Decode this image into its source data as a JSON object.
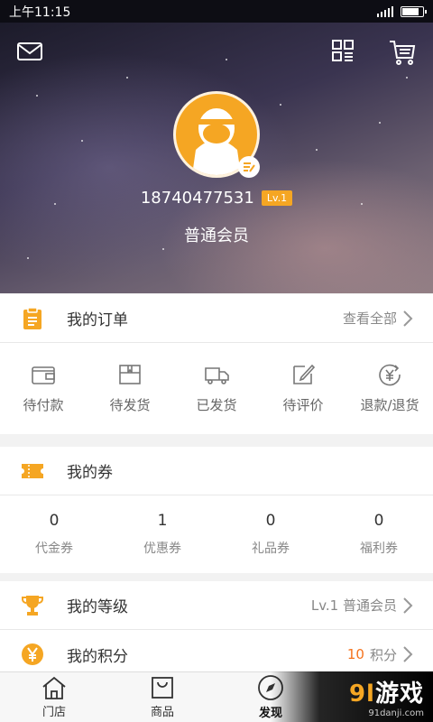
{
  "status_bar": {
    "time": "上午11:15"
  },
  "profile": {
    "phone": "18740477531",
    "level_badge": "Lv.1",
    "member_type": "普通会员"
  },
  "header_icons": [
    "mail-icon",
    "qr-code-icon",
    "cart-icon"
  ],
  "orders": {
    "title": "我的订单",
    "view_all": "查看全部",
    "items": [
      {
        "label": "待付款",
        "icon": "wallet-icon"
      },
      {
        "label": "待发货",
        "icon": "package-icon"
      },
      {
        "label": "已发货",
        "icon": "truck-icon"
      },
      {
        "label": "待评价",
        "icon": "edit-icon"
      },
      {
        "label": "退款/退货",
        "icon": "refund-icon"
      }
    ]
  },
  "coupons": {
    "title": "我的券",
    "items": [
      {
        "value": "0",
        "label": "代金券"
      },
      {
        "value": "1",
        "label": "优惠券"
      },
      {
        "value": "0",
        "label": "礼品券"
      },
      {
        "value": "0",
        "label": "福利券"
      }
    ]
  },
  "level": {
    "title": "我的等级",
    "value": "Lv.1 普通会员"
  },
  "points": {
    "title": "我的积分",
    "value": "10",
    "unit": "积分"
  },
  "tabs": [
    {
      "label": "门店",
      "icon": "store-icon"
    },
    {
      "label": "商品",
      "icon": "bag-icon"
    },
    {
      "label": "发现",
      "icon": "compass-icon"
    }
  ],
  "watermark": {
    "brand_a": "9l",
    "brand_b": "游戏",
    "site": "91danji.com"
  },
  "colors": {
    "accent": "#f5a623",
    "points_value": "#f5731d"
  }
}
